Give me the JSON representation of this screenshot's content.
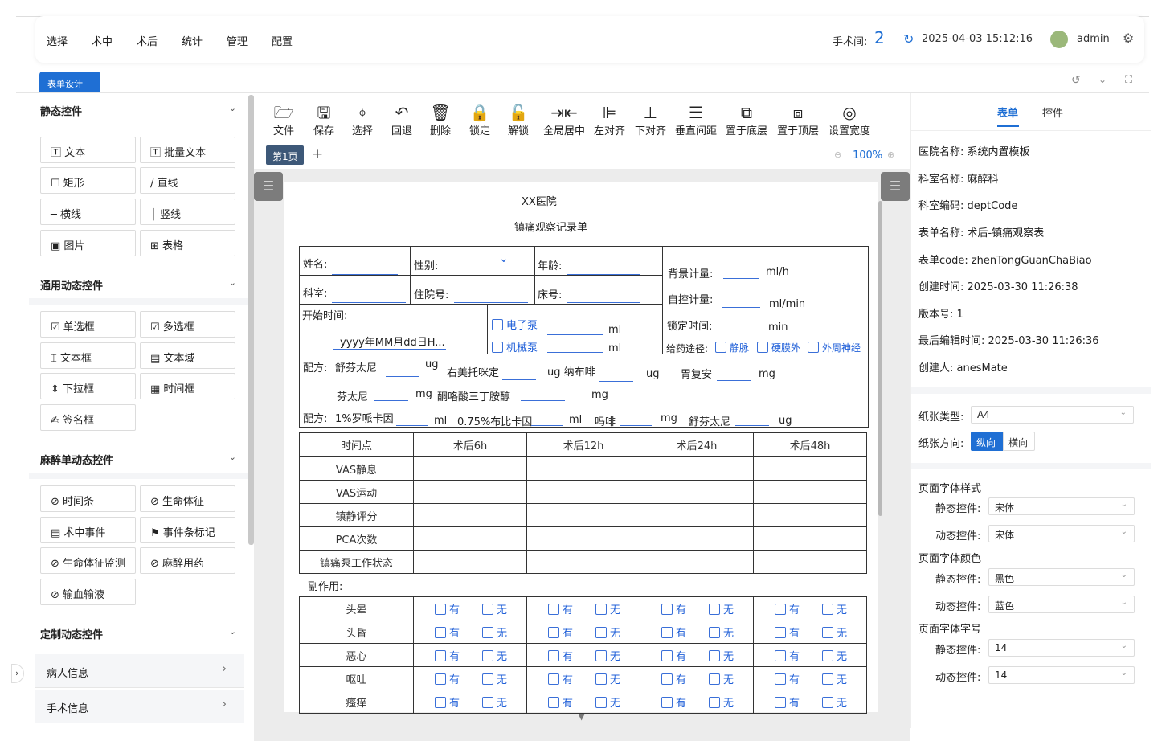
{
  "nav": {
    "items": [
      "选择",
      "术中",
      "术后",
      "统计",
      "管理",
      "配置"
    ]
  },
  "header": {
    "room_label": "手术间:",
    "room_value": "2",
    "datetime": "2025-04-03 15:12:16",
    "user": "admin"
  },
  "tab": {
    "label": "表单设计"
  },
  "left": {
    "sections": [
      "静态控件",
      "通用动态控件",
      "麻醉单动态控件",
      "定制动态控件"
    ],
    "static": [
      "文本",
      "批量文本",
      "矩形",
      "直线",
      "横线",
      "竖线",
      "图片",
      "表格"
    ],
    "common": [
      "单选框",
      "多选框",
      "文本框",
      "文本域",
      "下拉框",
      "时间框",
      "签名框"
    ],
    "anes": [
      "时间条",
      "生命体征",
      "术中事件",
      "事件条标记",
      "生命体征监测",
      "麻醉用药",
      "输血输液"
    ],
    "custom": [
      "病人信息",
      "手术信息"
    ]
  },
  "toolbar": {
    "items": [
      "文件",
      "保存",
      "选择",
      "回退",
      "删除",
      "锁定",
      "解锁",
      "全局居中",
      "左对齐",
      "下对齐",
      "垂直间距",
      "置于底层",
      "置于顶层",
      "设置宽度"
    ]
  },
  "pages": {
    "current": "第1页",
    "add": "+",
    "zoom": "100%"
  },
  "doc": {
    "hospital": "XX医院",
    "title": "镇痛观察记录单",
    "name": "姓名:",
    "gender": "性别:",
    "age": "年龄:",
    "dept": "科室:",
    "inpatient": "住院号:",
    "bed": "床号:",
    "start_time": "开始时间:",
    "start_placeholder": "yyyy年MM月dd日H...",
    "pump_e": "电子泵",
    "pump_m": "机械泵",
    "ml": "ml",
    "bg_dose": "背景计量:",
    "bg_unit": "ml/h",
    "self_dose": "自控计量:",
    "self_unit": "ml/min",
    "lock_time": "锁定时间:",
    "lock_unit": "min",
    "route": "给药途径:",
    "route_iv": "静脉",
    "route_epi": "硬膜外",
    "route_nerve": "外周神经",
    "formula": "配方:",
    "f1": "舒芬太尼",
    "ug": "ug",
    "f2": "右美托咪定",
    "f3": "ug 纳布啡",
    "f4": "胃复安",
    "mg": "mg",
    "f5": "芬太尼",
    "f6": "酮咯酸三丁胺醇",
    "f7": "1%罗哌卡因",
    "f8": "0.75%布比卡因",
    "f9": "吗啡",
    "f10": "舒芬太尼",
    "table_header": [
      "时间点",
      "术后6h",
      "术后12h",
      "术后24h",
      "术后48h"
    ],
    "table_rows": [
      "VAS静息",
      "VAS运动",
      "镇静评分",
      "PCA次数",
      "镇痛泵工作状态"
    ],
    "side_title": "副作用:",
    "side_rows": [
      "头晕",
      "头昏",
      "恶心",
      "呕吐",
      "瘙痒"
    ],
    "yes": "有",
    "no": "无"
  },
  "right": {
    "tabs": [
      "表单",
      "控件"
    ],
    "info": [
      "医院名称: 系统内置模板",
      "科室名称: 麻醉科",
      "科室编码: deptCode",
      "表单名称: 术后-镇痛观察表",
      "表单code: zhenTongGuanChaBiao",
      "创建时间: 2025-03-30 11:26:38",
      "版本号: 1",
      "最后编辑时间: 2025-03-30 11:26:36",
      "创建人: anesMate"
    ],
    "paper_type_label": "纸张类型:",
    "paper_type": "A4",
    "orient_label": "纸张方向:",
    "orient_v": "纵向",
    "orient_h": "横向",
    "font_style": "页面字体样式",
    "font_color": "页面字体颜色",
    "font_size": "页面字体字号",
    "static_label": "静态控件:",
    "dynamic_label": "动态控件:",
    "style_static": "宋体",
    "style_dynamic": "宋体",
    "color_static": "黑色",
    "color_dynamic": "蓝色",
    "size_static": "14",
    "size_dynamic": "14"
  },
  "colors": {
    "accent": "#1f6fd4",
    "form_blue": "#3a6fd8"
  }
}
